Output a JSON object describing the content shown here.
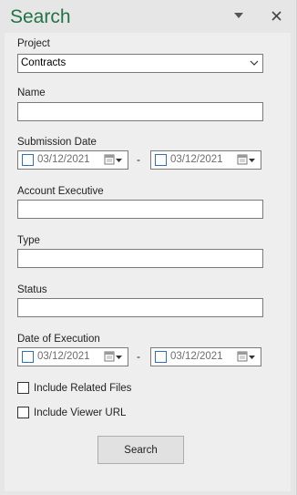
{
  "pane": {
    "title": "Search",
    "menu_icon": "dropdown-triangle-icon",
    "close_icon": "close-icon"
  },
  "form": {
    "project": {
      "label": "Project",
      "value": "Contracts"
    },
    "name": {
      "label": "Name",
      "value": ""
    },
    "submission_date": {
      "label": "Submission Date",
      "from": "03/12/2021",
      "to": "03/12/2021",
      "separator": "-"
    },
    "account_executive": {
      "label": "Account Executive",
      "value": ""
    },
    "type": {
      "label": "Type",
      "value": ""
    },
    "status": {
      "label": "Status",
      "value": ""
    },
    "date_of_execution": {
      "label": "Date of Execution",
      "from": "03/12/2021",
      "to": "03/12/2021",
      "separator": "-"
    },
    "include_related_files": {
      "label": "Include Related Files",
      "checked": false
    },
    "include_viewer_url": {
      "label": "Include Viewer URL",
      "checked": false
    },
    "search_button": "Search"
  },
  "colors": {
    "title": "#217346",
    "pane_bg": "#e6e6e6",
    "content_bg": "#eeeeee",
    "checkbox_border": "#2f6fbf"
  }
}
